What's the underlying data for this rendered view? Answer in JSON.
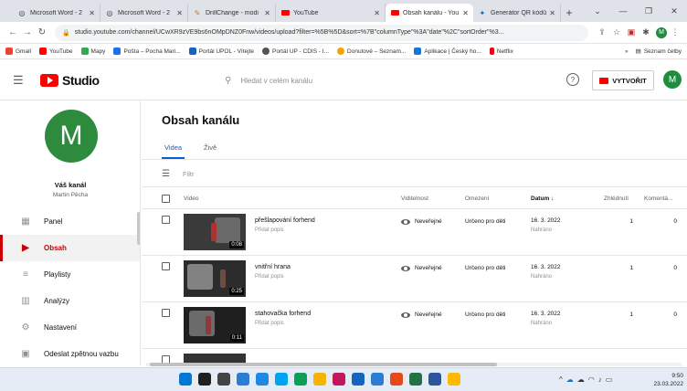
{
  "browser": {
    "tabs": [
      {
        "label": "Microsoft Word - 2",
        "icon": "word-icon",
        "active": false
      },
      {
        "label": "Microsoft Word - 2",
        "icon": "word-icon",
        "active": false
      },
      {
        "label": "DrillChange - modi",
        "icon": "drill-icon",
        "active": false
      },
      {
        "label": "YouTube",
        "icon": "youtube-icon",
        "active": false
      },
      {
        "label": "Obsah kanálu - You",
        "icon": "youtube-icon",
        "active": true
      },
      {
        "label": "Generátor QR kódů",
        "icon": "qr-icon",
        "active": false
      }
    ],
    "url": "studio.youtube.com/channel/UCwXR9zVE9bs6nOMpDNZ0Fnw/videos/upload?filter=%5B%5D&sort=%7B\"columnType\"%3A\"date\"%2C\"sortOrder\"%3...",
    "bookmarks": [
      "Gmail",
      "YouTube",
      "Mapy",
      "Pošta – Pocha Mari...",
      "Portál UPOL - Vítejte",
      "Portál UP - CDIS - I...",
      "Donutové – Seznam...",
      "Aplikace | Český ho...",
      "Netflix"
    ],
    "bookmarks_right": "Seznam četby",
    "colors": {
      "gmail": "#ea4335",
      "youtube": "#ff0000",
      "mapy": "#34a853",
      "posta": "#1a73e8",
      "upol": "#1565c0",
      "up": "#555555",
      "donut": "#f4a300",
      "aplikace": "#1976d2",
      "netflix": "#e50914"
    }
  },
  "studio": {
    "logo_text": "Studio",
    "search_placeholder": "Hledat v celém kanálu",
    "create_label": "VYTVOŘIT",
    "avatar_letter": "M",
    "accent": "#cc0000",
    "link_blue": "#065fd4"
  },
  "sidebar": {
    "avatar_letter": "M",
    "channel_title": "Váš kanál",
    "channel_owner": "Martin Pěcha",
    "items": [
      {
        "label": "Panel",
        "icon": "dashboard-icon",
        "active": false
      },
      {
        "label": "Obsah",
        "icon": "content-icon",
        "active": true
      },
      {
        "label": "Playlisty",
        "icon": "playlist-icon",
        "active": false
      },
      {
        "label": "Analýzy",
        "icon": "analytics-icon",
        "active": false
      },
      {
        "label": "Nastavení",
        "icon": "gear-icon",
        "active": false
      },
      {
        "label": "Odeslat zpětnou vazbu",
        "icon": "feedback-icon",
        "active": false
      }
    ]
  },
  "main": {
    "title": "Obsah kanálu",
    "tabs": [
      {
        "label": "Videa",
        "active": true
      },
      {
        "label": "Živě",
        "active": false
      }
    ],
    "filter_placeholder": "Filtr",
    "columns": {
      "video": "Video",
      "visibility": "Viditelnost",
      "restrictions": "Omezení",
      "date": "Datum ↓",
      "views": "Zhlédnutí",
      "comments": "Komentá..."
    },
    "rows": [
      {
        "title": "přešlapování forhend",
        "desc": "Přidat popis",
        "duration": "0:08",
        "visibility": "Neveřejné",
        "restriction": "Určeno pro děti",
        "date": "16. 3. 2022",
        "date_status": "Nahráno",
        "views": "1",
        "comments": "0"
      },
      {
        "title": "vnitřní hrana",
        "desc": "Přidat popis",
        "duration": "0:25",
        "visibility": "Neveřejné",
        "restriction": "Určeno pro děti",
        "date": "16. 3. 2022",
        "date_status": "Nahráno",
        "views": "1",
        "comments": "0"
      },
      {
        "title": "stahovačka forhend",
        "desc": "Přidat popis",
        "duration": "0:11",
        "visibility": "Neveřejné",
        "restriction": "Určeno pro děti",
        "date": "16. 3. 2022",
        "date_status": "Nahráno",
        "views": "1",
        "comments": "0"
      }
    ]
  },
  "taskbar": {
    "time": "9:50",
    "date": "23.03.2022",
    "app_colors": [
      "#0078d4",
      "#202020",
      "#444444",
      "#2b7cd3",
      "#1e88e5",
      "#00a4ef",
      "#0f9d58",
      "#f4b400",
      "#c2185b",
      "#1565c0",
      "#2b7cd3",
      "#e64a19",
      "#217346",
      "#2b579a",
      "#ffb900"
    ]
  }
}
